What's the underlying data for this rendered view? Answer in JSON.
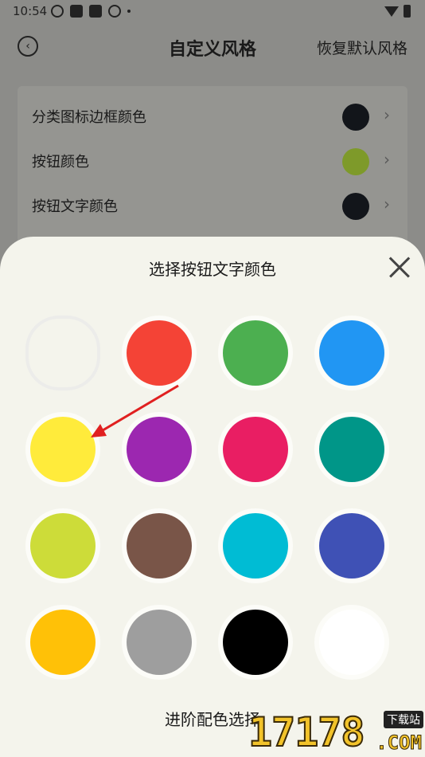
{
  "status_bar": {
    "time": "10:54"
  },
  "header": {
    "title": "自定义风格",
    "reset_label": "恢复默认风格"
  },
  "settings": [
    {
      "label": "分类图标边框颜色",
      "color": "#12151a"
    },
    {
      "label": "按钮颜色",
      "color": "#7e9a2a"
    },
    {
      "label": "按钮文字颜色",
      "color": "#12151a"
    }
  ],
  "sheet": {
    "title": "选择按钮文字颜色",
    "colors": [
      "transparent",
      "#f44336",
      "#4caf50",
      "#2196f3",
      "#ffeb3b",
      "#9c27b0",
      "#e91e63",
      "#009688",
      "#cddc39",
      "#795548",
      "#00bcd4",
      "#3f51b5",
      "#ffc107",
      "#9e9e9e",
      "#000000",
      "#ffffff"
    ],
    "advanced_label": "进阶配色选择"
  },
  "annotation": {
    "arrow_color": "#e02020"
  },
  "watermark": {
    "number": "17178",
    "tag": "下载站",
    "suffix": ".COM"
  }
}
